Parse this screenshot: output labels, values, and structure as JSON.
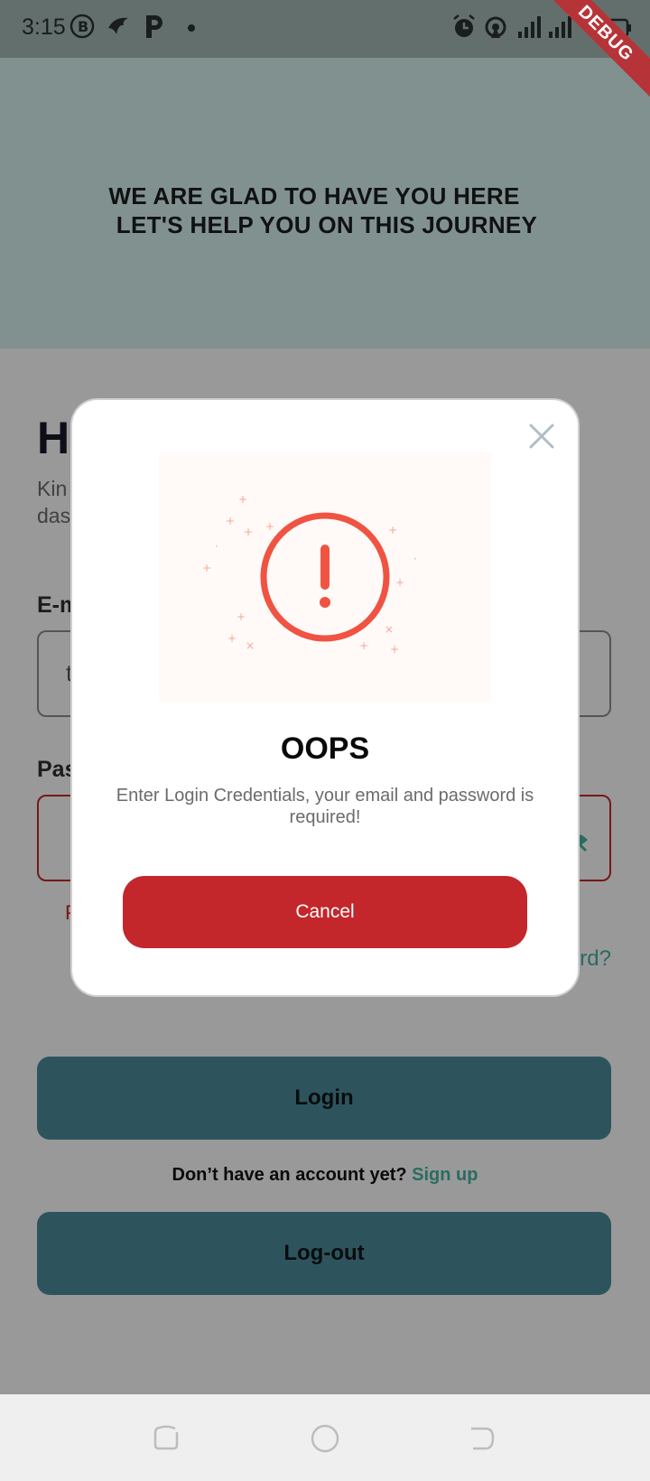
{
  "status_bar": {
    "time": "3:15",
    "icons": [
      "b-circle-icon",
      "eagle-icon",
      "p-icon",
      "dot-icon",
      "alarm-icon",
      "hotspot-icon",
      "signal-icon",
      "signal-4g-icon",
      "battery-icon"
    ]
  },
  "debug_banner": "DEBUG",
  "header": {
    "line1": "WE ARE GLAD TO HAVE YOU HERE",
    "line2": "LET'S HELP YOU ON THIS JOURNEY"
  },
  "login_form": {
    "greeting": "He",
    "subtitle_line1": "Kin",
    "subtitle_line2": "das",
    "email_label": "E-m",
    "email_value": "t",
    "password_label": "Pas",
    "password_error": "P",
    "forgot_password": "ord?",
    "login_button": "Login",
    "signup_prompt": "Don’t have an account yet?",
    "signup_link": "Sign up",
    "logout_button": "Log-out"
  },
  "dialog": {
    "title": "OOPS",
    "message": "Enter Login Credentials, your email and password is required!",
    "cancel_button": "Cancel",
    "illustration_icon": "exclamation-circle-icon"
  },
  "colors": {
    "header_bg": "#d7f2ee",
    "primary_button": "#4c8d9c",
    "link": "#47b4a3",
    "error": "#c62828",
    "cancel_button": "#c3272b",
    "alert_red": "#f05342"
  },
  "nav_bar": {
    "icons": [
      "recent-apps-icon",
      "home-icon",
      "back-icon"
    ]
  }
}
